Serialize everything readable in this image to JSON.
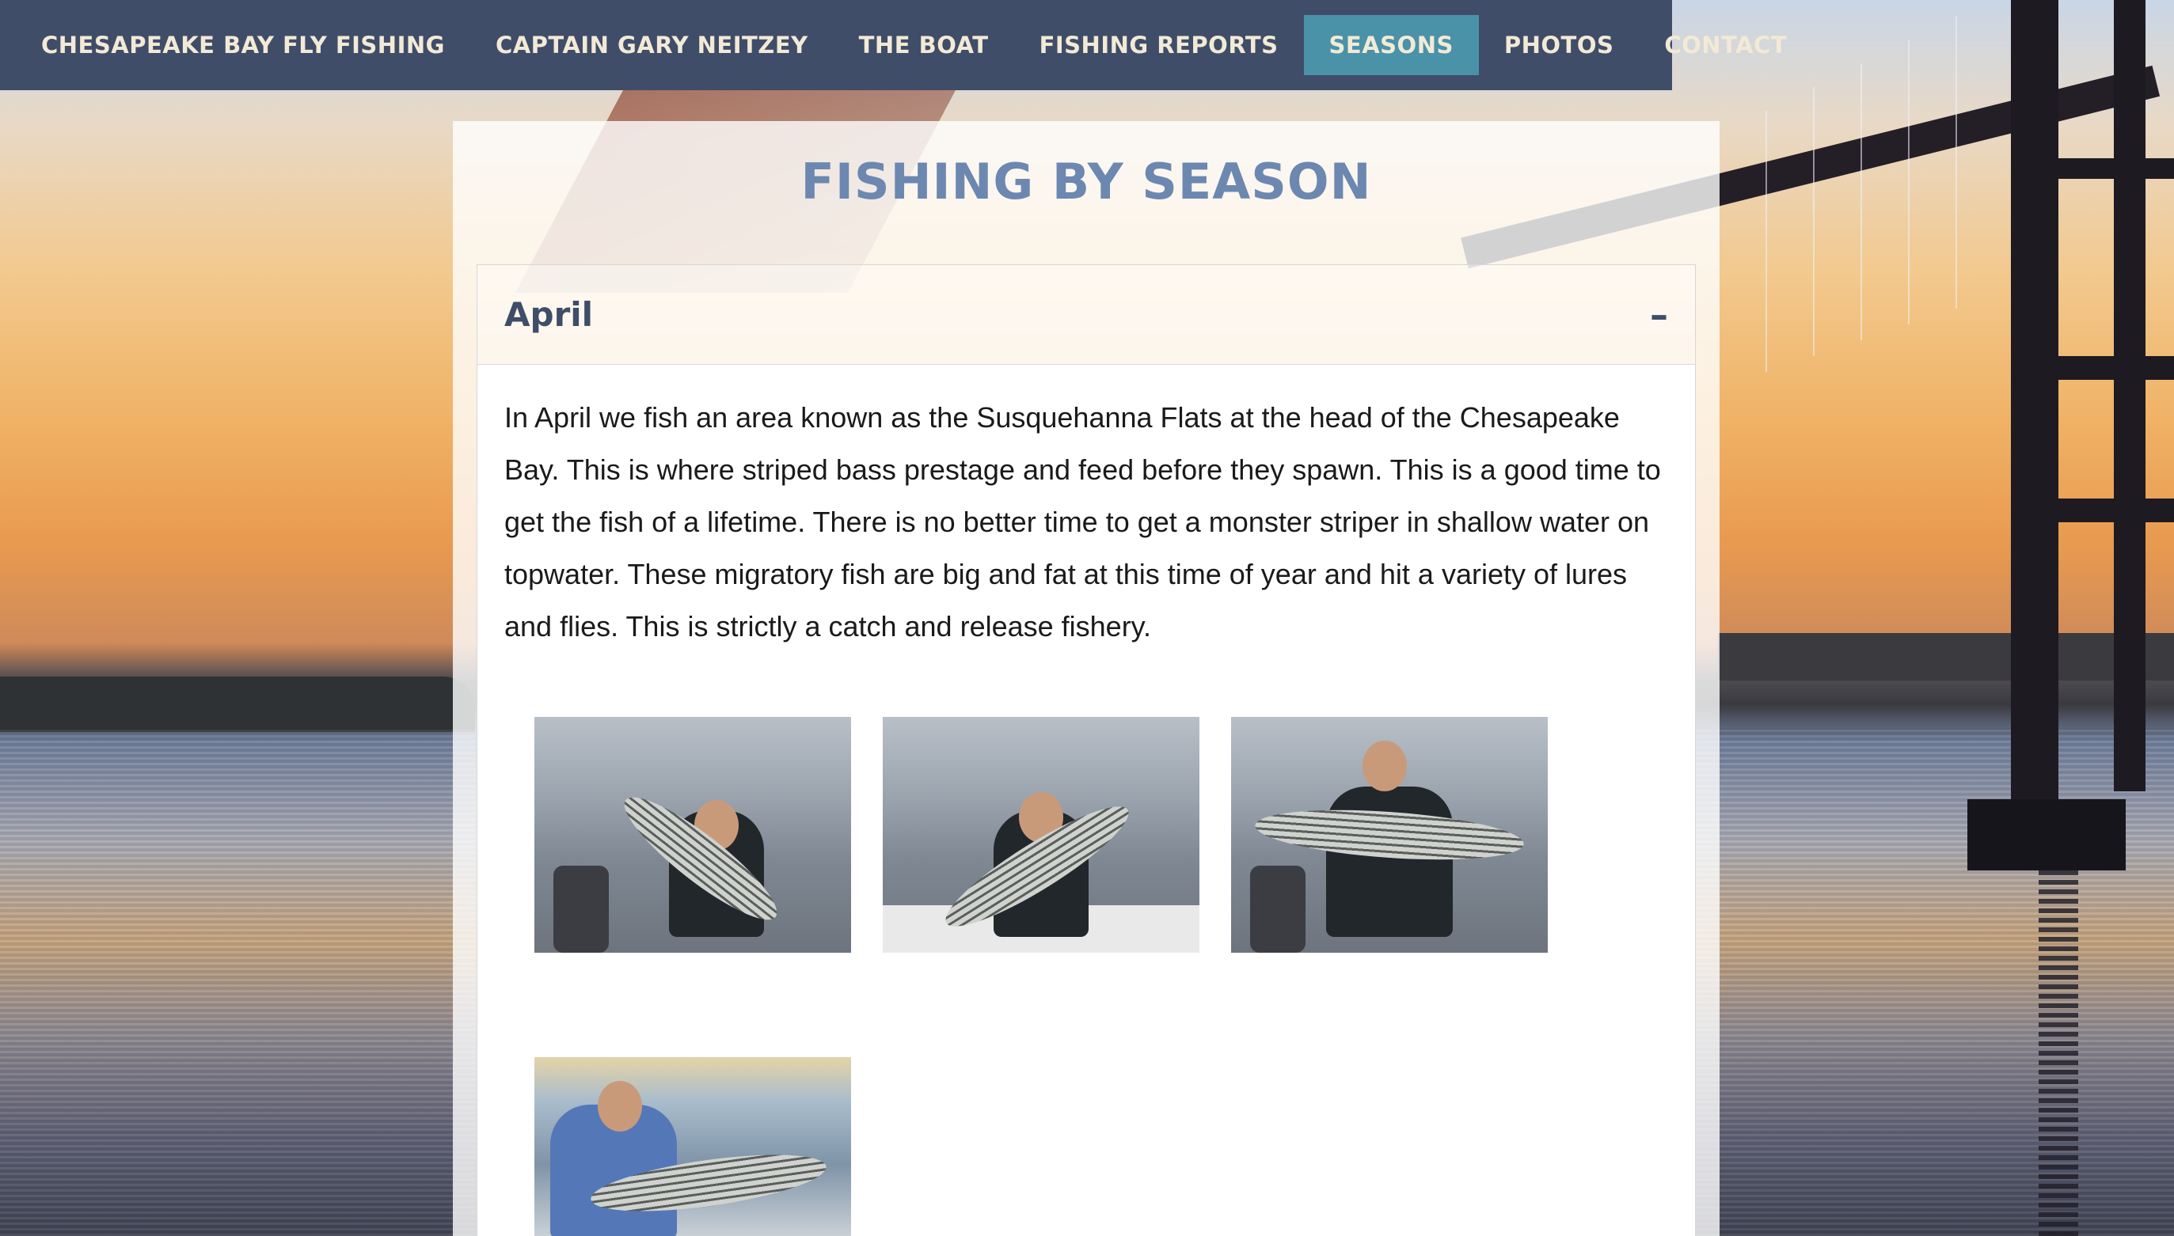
{
  "nav": {
    "items": [
      {
        "label": "CHESAPEAKE BAY FLY FISHING",
        "active": false
      },
      {
        "label": "CAPTAIN GARY NEITZEY",
        "active": false
      },
      {
        "label": "THE BOAT",
        "active": false
      },
      {
        "label": "FISHING REPORTS",
        "active": false
      },
      {
        "label": "SEASONS",
        "active": true
      },
      {
        "label": "PHOTOS",
        "active": false
      },
      {
        "label": "CONTACT",
        "active": false
      }
    ]
  },
  "page": {
    "title": "FISHING BY SEASON"
  },
  "accordion": {
    "title": "April",
    "toggle": "–",
    "body": "In April we fish an area known as the Susquehanna Flats at the head of the Chesapeake Bay. This is where striped bass prestage and feed before they spawn. This is a good time to get the fish of a lifetime. There is no better time to get a monster striper in shallow water on topwater. These migratory fish are big and fat at this time of year and hit a variety of lures and flies. This is strictly a catch and release fishery."
  },
  "colors": {
    "nav_bg": "#3f4d69",
    "nav_active": "#4a92a8",
    "nav_text": "#f2ead6",
    "title": "#6c88b0",
    "heading": "#3f4d69"
  },
  "gallery": {
    "photos": [
      {
        "name": "striper-photo-1"
      },
      {
        "name": "striper-photo-2"
      },
      {
        "name": "striper-photo-3"
      },
      {
        "name": "striper-photo-4"
      }
    ]
  }
}
